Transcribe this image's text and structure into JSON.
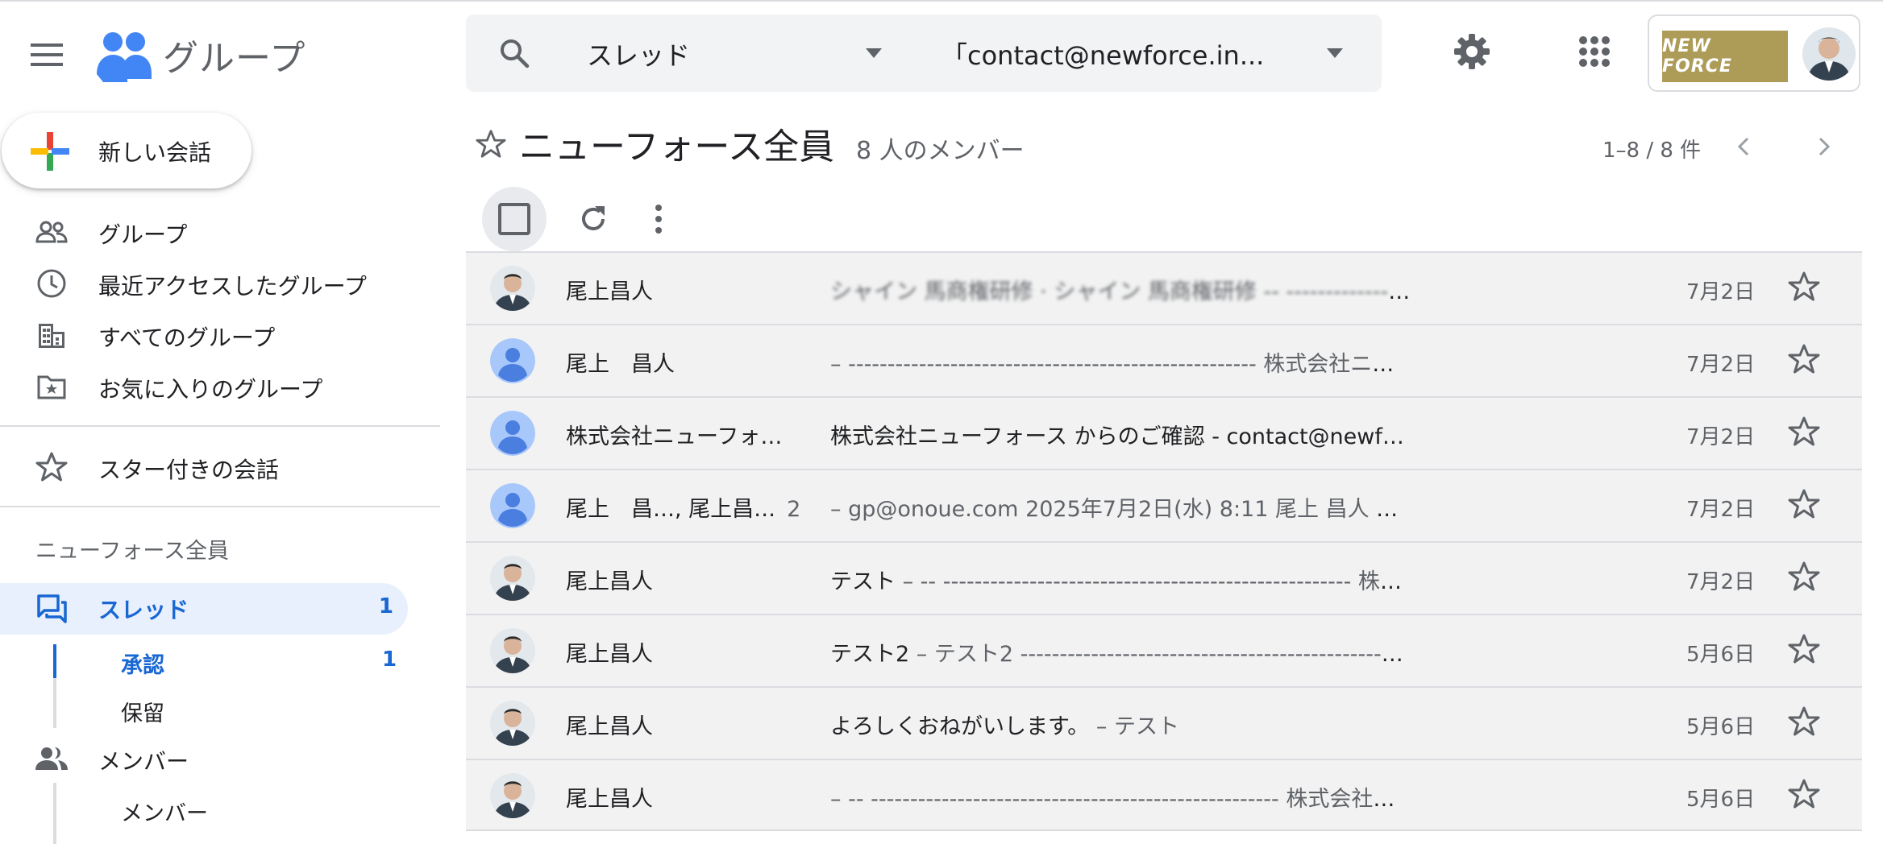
{
  "app": {
    "title": "グループ"
  },
  "search": {
    "scope": "スレッド",
    "group": "「contact@newforce.in..."
  },
  "account": {
    "brand": "NEW FORCE"
  },
  "sidebar": {
    "new_conversation": "新しい会話",
    "items": [
      {
        "label": "グループ",
        "icon": "groups-icon"
      },
      {
        "label": "最近アクセスしたグループ",
        "icon": "clock-icon"
      },
      {
        "label": "すべてのグループ",
        "icon": "building-icon"
      },
      {
        "label": "お気に入りのグループ",
        "icon": "folder-star-icon"
      }
    ],
    "starred": "スター付きの会話",
    "group_name": "ニューフォース全員",
    "threads": {
      "label": "スレッド",
      "count": "1"
    },
    "approval": {
      "label": "承認",
      "count": "1"
    },
    "pending": {
      "label": "保留"
    },
    "members": {
      "label": "メンバー"
    },
    "members_sub": {
      "label": "メンバー"
    }
  },
  "main": {
    "title": "ニューフォース全員",
    "member_count": "8 人のメンバー",
    "pagination": "1–8 / 8 件"
  },
  "conversations": [
    {
      "sender": "尾上昌人",
      "count": "",
      "subject": "",
      "preview": "シャイン 馬商権研修 · シャイン 馬商権研修 -- ---------------...",
      "blurred": true,
      "date": "7月2日",
      "avatar": "photo"
    },
    {
      "sender": "尾上　昌人",
      "count": "",
      "subject": "",
      "preview": "– ---------------------------------------------------- 株式会社ニュー...",
      "blurred": false,
      "date": "7月2日",
      "avatar": "default"
    },
    {
      "sender": "株式会社ニューフォ…",
      "count": "",
      "subject": "株式会社ニューフォース からのご確認 - contact@newforce.in",
      "preview": "",
      "blurred": false,
      "date": "7月2日",
      "avatar": "default"
    },
    {
      "sender": "尾上　昌…, 尾上昌…",
      "count": "2",
      "subject": "",
      "preview": "– gp@onoue.com 2025年7月2日(水) 8:11 尾上 昌人 <...",
      "blurred": false,
      "date": "7月2日",
      "avatar": "default"
    },
    {
      "sender": "尾上昌人",
      "count": "",
      "subject": "テスト",
      "preview": " – -- ---------------------------------------------------- 株式会...",
      "blurred": false,
      "date": "7月2日",
      "avatar": "photo"
    },
    {
      "sender": "尾上昌人",
      "count": "",
      "subject": "テスト2",
      "preview": " – テスト2 ---------------------------------------------------- ...",
      "blurred": false,
      "date": "5月6日",
      "avatar": "photo"
    },
    {
      "sender": "尾上昌人",
      "count": "",
      "subject": "よろしくおねがいします。",
      "preview": " – テスト",
      "blurred": false,
      "date": "5月6日",
      "avatar": "photo"
    },
    {
      "sender": "尾上昌人",
      "count": "",
      "subject": "",
      "preview": "– -- ---------------------------------------------------- 株式会社ニュ...",
      "blurred": false,
      "date": "5月6日",
      "avatar": "photo"
    }
  ],
  "colors": {
    "accent": "#1967d2",
    "selected_bg": "#e8f0fe",
    "row_bg": "#f2f2f2",
    "brand_gold": "#ad9b58"
  }
}
